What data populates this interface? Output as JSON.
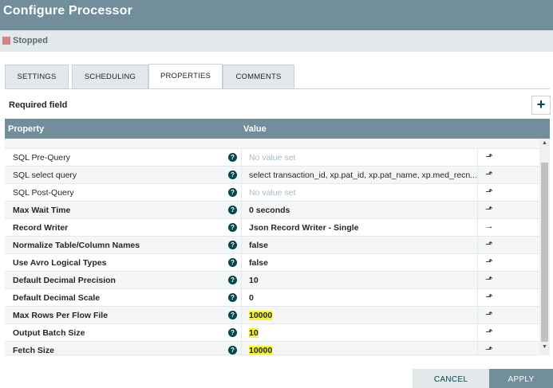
{
  "window": {
    "title": "Configure Processor",
    "status": "Stopped",
    "status_color": "#d18686",
    "accent_color": "#728e9b"
  },
  "tabs": [
    {
      "label": "SETTINGS"
    },
    {
      "label": "SCHEDULING"
    },
    {
      "label": "PROPERTIES",
      "active": true
    },
    {
      "label": "COMMENTS"
    }
  ],
  "properties_panel": {
    "required_label": "Required field",
    "add_icon": "plus-icon",
    "header": {
      "property": "Property",
      "value": "Value"
    },
    "rows": [
      {
        "name": "SQL Pre-Query",
        "value": "No value set",
        "action": "arrow-up-icon"
      },
      {
        "name": "SQL select query",
        "value": "select transaction_id, xp.pat_id, xp.pat_name, xp.med_recn...",
        "action": "arrow-up-icon"
      },
      {
        "name": "SQL Post-Query",
        "value": "No value set",
        "action": "arrow-up-icon"
      },
      {
        "name": "Max Wait Time",
        "value": "0 seconds",
        "action": "arrow-up-icon"
      },
      {
        "name": "Record Writer",
        "value": "Json Record Writer - Single",
        "action": "arrow-right-icon"
      },
      {
        "name": "Normalize Table/Column Names",
        "value": "false",
        "action": "arrow-up-icon"
      },
      {
        "name": "Use Avro Logical Types",
        "value": "false",
        "action": "arrow-up-icon"
      },
      {
        "name": "Default Decimal Precision",
        "value": "10",
        "action": "arrow-up-icon"
      },
      {
        "name": "Default Decimal Scale",
        "value": "0",
        "action": "arrow-up-icon"
      },
      {
        "name": "Max Rows Per Flow File",
        "value": "10000",
        "action": "arrow-up-icon"
      },
      {
        "name": "Output Batch Size",
        "value": "10",
        "action": "arrow-up-icon"
      },
      {
        "name": "Fetch Size",
        "value": "10000",
        "action": "arrow-up-icon"
      }
    ]
  },
  "footer": {
    "cancel_label": "CANCEL",
    "apply_label": "APPLY"
  },
  "glyphs": {
    "help": "?",
    "plus": "+",
    "arrow_up": "⬏",
    "arrow_right": "→",
    "scroll_up": "▲",
    "scroll_down": "▼"
  }
}
